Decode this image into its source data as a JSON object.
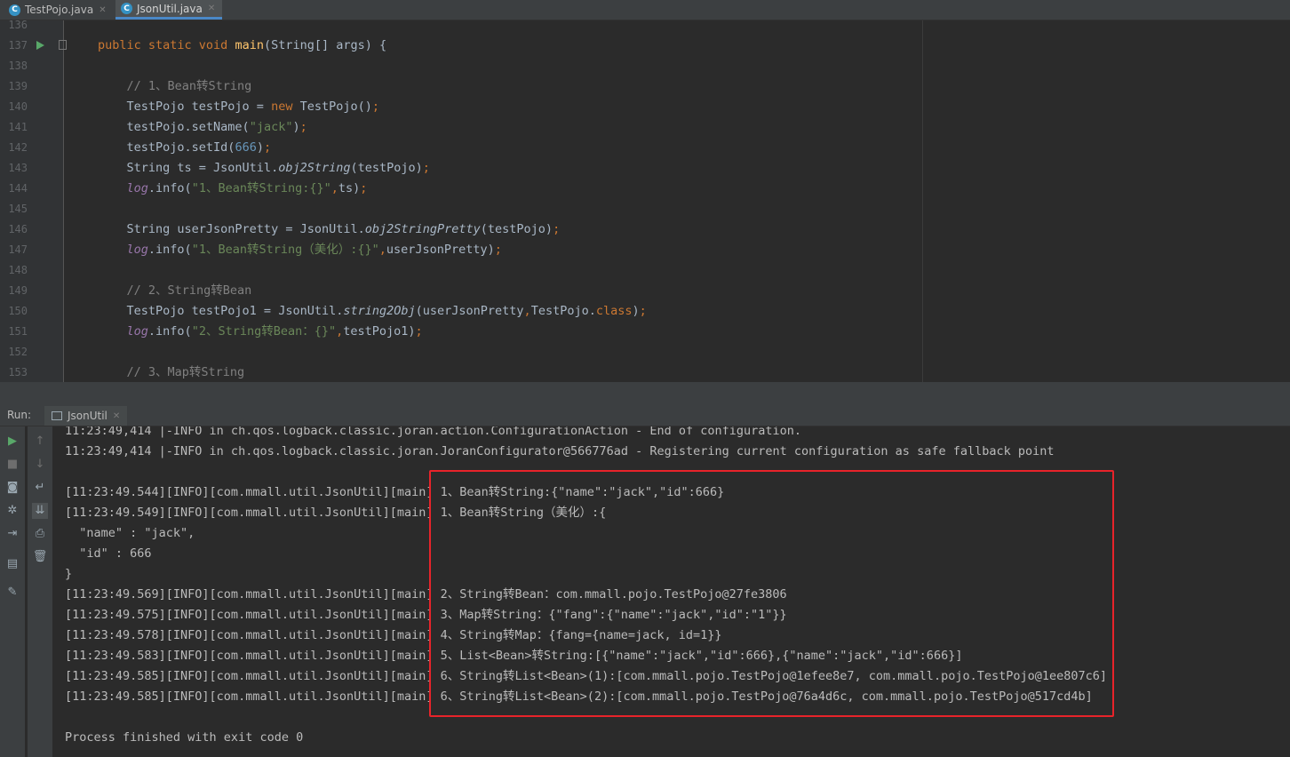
{
  "tabs": [
    {
      "label": "TestPojo.java",
      "icon": "C",
      "active": false
    },
    {
      "label": "JsonUtil.java",
      "icon": "C",
      "active": true
    }
  ],
  "editor": {
    "lines": [
      {
        "num": "136",
        "html": ""
      },
      {
        "num": "137",
        "html": "<span class=\"kw\">public static void </span><span class=\"fn\">main</span>(String[] args) {"
      },
      {
        "num": "138",
        "html": ""
      },
      {
        "num": "139",
        "html": "    <span class=\"cm\">// 1、Bean转String</span>"
      },
      {
        "num": "140",
        "html": "    TestPojo testPojo = <span class=\"kw\">new </span>TestPojo()<span class=\"kw\">;</span>"
      },
      {
        "num": "141",
        "html": "    testPojo.setName(<span class=\"str\">\"jack\"</span>)<span class=\"kw\">;</span>"
      },
      {
        "num": "142",
        "html": "    testPojo.setId(<span class=\"num\">666</span>)<span class=\"kw\">;</span>"
      },
      {
        "num": "143",
        "html": "    String ts = JsonUtil.<span class=\"it\">obj2String</span>(testPojo)<span class=\"kw\">;</span>"
      },
      {
        "num": "144",
        "html": "    <span class=\"log\">log</span>.info(<span class=\"str\">\"1、Bean转String:{}\"</span><span class=\"kw\">,</span>ts)<span class=\"kw\">;</span>"
      },
      {
        "num": "145",
        "html": ""
      },
      {
        "num": "146",
        "html": "    String userJsonPretty = JsonUtil.<span class=\"it\">obj2StringPretty</span>(testPojo)<span class=\"kw\">;</span>"
      },
      {
        "num": "147",
        "html": "    <span class=\"log\">log</span>.info(<span class=\"str\">\"1、Bean转String（美化）:{}\"</span><span class=\"kw\">,</span>userJsonPretty)<span class=\"kw\">;</span>"
      },
      {
        "num": "148",
        "html": ""
      },
      {
        "num": "149",
        "html": "    <span class=\"cm\">// 2、String转Bean</span>"
      },
      {
        "num": "150",
        "html": "    TestPojo testPojo1 = JsonUtil.<span class=\"it\">string2Obj</span>(userJsonPretty<span class=\"kw\">,</span>TestPojo.<span class=\"kw\">class</span>)<span class=\"kw\">;</span>"
      },
      {
        "num": "151",
        "html": "    <span class=\"log\">log</span>.info(<span class=\"str\">\"2、String转Bean：{}\"</span><span class=\"kw\">,</span>testPojo1)<span class=\"kw\">;</span>"
      },
      {
        "num": "152",
        "html": ""
      },
      {
        "num": "153",
        "html": "    <span class=\"cm\">// 3、Map转String</span>"
      }
    ]
  },
  "run_panel": {
    "label": "Run:",
    "tab_label": "JsonUtil"
  },
  "console": {
    "lines": [
      "11:23:49,414 |-INFO in ch.qos.logback.classic.joran.action.ConfigurationAction - End of configuration.",
      "11:23:49,414 |-INFO in ch.qos.logback.classic.joran.JoranConfigurator@566776ad - Registering current configuration as safe fallback point",
      "",
      "[11:23:49.544][INFO][com.mmall.util.JsonUtil][main] 1、Bean转String:{\"name\":\"jack\",\"id\":666}",
      "[11:23:49.549][INFO][com.mmall.util.JsonUtil][main] 1、Bean转String（美化）:{",
      "  \"name\" : \"jack\",",
      "  \"id\" : 666",
      "}",
      "[11:23:49.569][INFO][com.mmall.util.JsonUtil][main] 2、String转Bean：com.mmall.pojo.TestPojo@27fe3806",
      "[11:23:49.575][INFO][com.mmall.util.JsonUtil][main] 3、Map转String：{\"fang\":{\"name\":\"jack\",\"id\":\"1\"}}",
      "[11:23:49.578][INFO][com.mmall.util.JsonUtil][main] 4、String转Map：{fang={name=jack, id=1}}",
      "[11:23:49.583][INFO][com.mmall.util.JsonUtil][main] 5、List<Bean>转String:[{\"name\":\"jack\",\"id\":666},{\"name\":\"jack\",\"id\":666}]",
      "[11:23:49.585][INFO][com.mmall.util.JsonUtil][main] 6、String转List<Bean>(1):[com.mmall.pojo.TestPojo@1efee8e7, com.mmall.pojo.TestPojo@1ee807c6]",
      "[11:23:49.585][INFO][com.mmall.util.JsonUtil][main] 6、String转List<Bean>(2):[com.mmall.pojo.TestPojo@76a4d6c, com.mmall.pojo.TestPojo@517cd4b]",
      "",
      "Process finished with exit code 0"
    ]
  },
  "colors": {
    "highlight_border": "#e8232a",
    "run_green": "#59a869"
  }
}
